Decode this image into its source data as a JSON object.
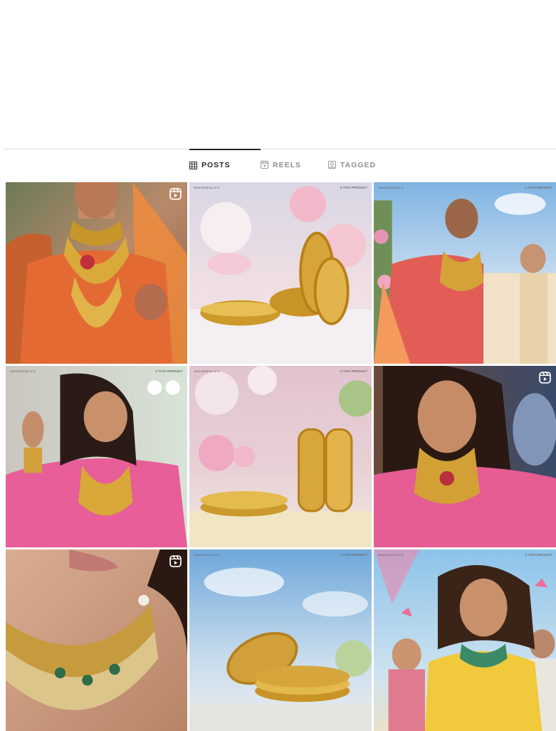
{
  "tabs": [
    {
      "label": "POSTS",
      "icon": "grid-icon",
      "active": true
    },
    {
      "label": "REELS",
      "icon": "reels-icon",
      "active": false
    },
    {
      "label": "TAGGED",
      "icon": "tagged-icon",
      "active": false
    }
  ],
  "posts": [
    {
      "subject": "bride-orange-sari-gold-necklace",
      "is_reel": true,
      "brand_left": "",
      "brand_right": ""
    },
    {
      "subject": "gold-bangles-pink-flowers",
      "is_reel": false,
      "brand_left": "www.tanishq.co.in",
      "brand_right": "A TATA PRODUCT"
    },
    {
      "subject": "bride-red-sari-groom",
      "is_reel": false,
      "brand_left": "www.tanishq.co.in",
      "brand_right": "A TATA PRODUCT"
    },
    {
      "subject": "bride-pink-lehenga-dancing",
      "is_reel": false,
      "brand_left": "www.tanishq.co.in",
      "brand_right": "A TATA PRODUCT"
    },
    {
      "subject": "kundan-gold-bangles-pink-backdrop",
      "is_reel": false,
      "brand_left": "www.tanishq.co.in",
      "brand_right": "A TATA PRODUCT"
    },
    {
      "subject": "bride-pink-smiling-nose-ring",
      "is_reel": true,
      "brand_left": "",
      "brand_right": ""
    },
    {
      "subject": "kundan-necklace-closeup",
      "is_reel": true,
      "brand_left": "",
      "brand_right": ""
    },
    {
      "subject": "kundan-bangles-sky-backdrop",
      "is_reel": false,
      "brand_left": "www.tanishq.co.in",
      "brand_right": "A TATA PRODUCT"
    },
    {
      "subject": "bride-yellow-outfit-flowers",
      "is_reel": false,
      "brand_left": "www.tanishq.co.in",
      "brand_right": "A TATA PRODUCT"
    }
  ]
}
